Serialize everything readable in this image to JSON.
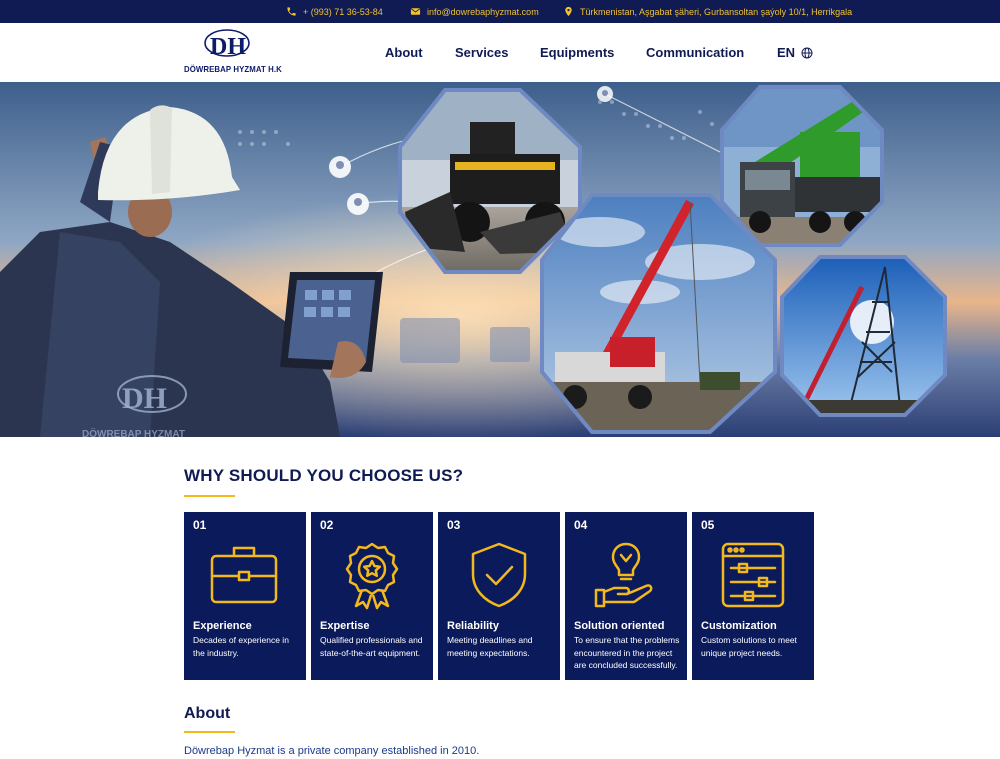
{
  "topbar": {
    "phone": "+ (993) 71 36-53-84",
    "email": "info@dowrebaphyzmat.com",
    "address": "Türkmenistan, Aşgabat şäheri, Gurbansoltan şaýoly 10/1, Herrikgala"
  },
  "header": {
    "logo_monogram": "DH",
    "logo_text": "DÖWREBAP HYZMAT H.K",
    "nav": [
      "About",
      "Services",
      "Equipments",
      "Communication"
    ],
    "language": "EN"
  },
  "hero": {
    "watermark_monogram": "DH",
    "watermark_text": "DÖWREBAP HYZMAT"
  },
  "why": {
    "title": "WHY SHOULD YOU CHOOSE US?",
    "cards": [
      {
        "num": "01",
        "title": "Experience",
        "desc": "Decades of experience in the industry.",
        "icon": "briefcase-icon"
      },
      {
        "num": "02",
        "title": "Expertise",
        "desc": "Qualified professionals and state-of-the-art equipment.",
        "icon": "award-ribbon-icon"
      },
      {
        "num": "03",
        "title": "Reliability",
        "desc": "Meeting deadlines and meeting expectations.",
        "icon": "shield-check-icon"
      },
      {
        "num": "04",
        "title": "Solution oriented",
        "desc": "To ensure that the problems encountered in the project are concluded successfully.",
        "icon": "lightbulb-hand-icon"
      },
      {
        "num": "05",
        "title": "Customization",
        "desc": "Custom solutions to meet unique project needs.",
        "icon": "settings-sliders-icon"
      }
    ]
  },
  "about": {
    "title": "About",
    "text": "Döwrebap Hyzmat is a private company established in 2010."
  },
  "colors": {
    "navy": "#0f1b52",
    "card_bg": "#0b1a5a",
    "accent": "#f2b81c"
  }
}
